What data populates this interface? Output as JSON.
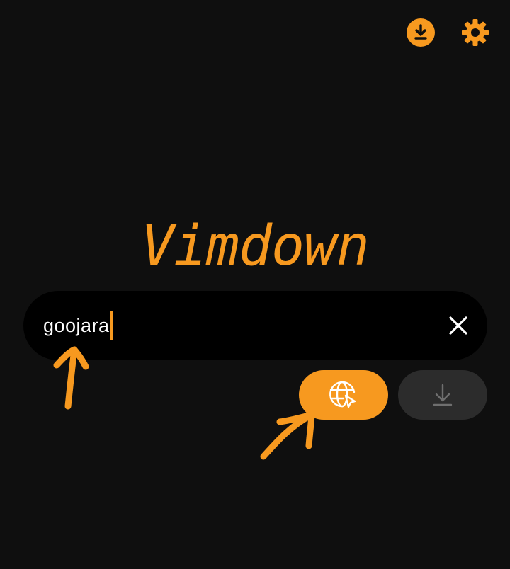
{
  "header": {
    "download_icon": "download-circle-icon",
    "settings_icon": "gear-icon"
  },
  "logo": {
    "text": "Vimdown"
  },
  "search": {
    "value": "goojara",
    "clear_icon": "close-icon"
  },
  "actions": {
    "browse_icon": "globe-cursor-icon",
    "download_icon": "download-arrow-icon",
    "download_enabled": false
  },
  "colors": {
    "accent": "#f7991f",
    "background": "#0f0f0f",
    "search_background": "#000000",
    "disabled_button": "#2c2c2c",
    "disabled_icon": "#6f6f6f"
  }
}
